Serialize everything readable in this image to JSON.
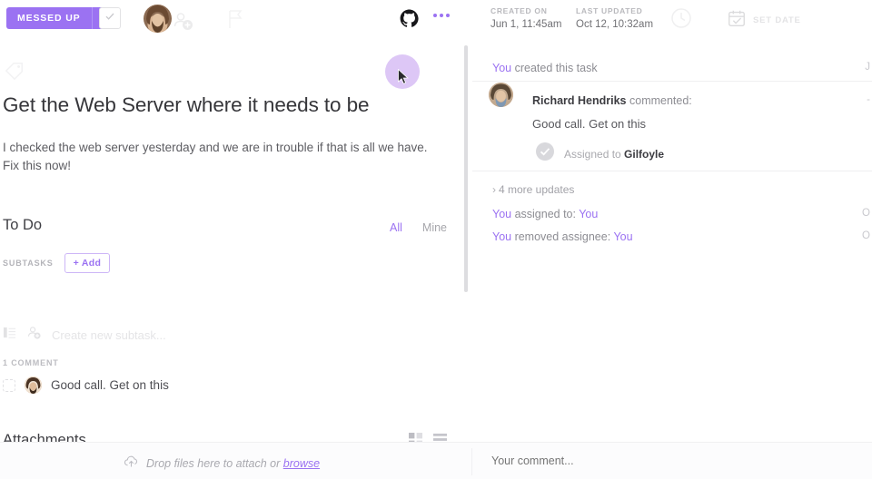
{
  "topbar": {
    "status_label": "MESSED UP",
    "status_color": "#9b72f2",
    "caret_icon": "caret-right-icon",
    "check_icon": "checkmark-icon",
    "assignee_avatar": "avatar",
    "add_assignee_icon": "add-person-icon",
    "flag_icon": "flag-icon",
    "github_icon": "github-icon",
    "more_icon": "ellipsis-icon",
    "created": {
      "label": "CREATED ON",
      "value": "Jun 1, 11:45am"
    },
    "updated": {
      "label": "LAST UPDATED",
      "value": "Oct 12, 10:32am"
    },
    "timer_icon": "clock-icon",
    "set_date": {
      "icon": "calendar-icon",
      "label": "SET DATE"
    }
  },
  "task": {
    "tag_icon": "tag-icon",
    "title": "Get the Web Server where it needs to be",
    "description": "I checked the web server yesterday and we are in trouble if that is all we have. Fix this now!"
  },
  "todo": {
    "heading": "To Do",
    "filters": [
      {
        "label": "All",
        "active": true
      },
      {
        "label": "Mine",
        "active": false
      }
    ],
    "subtasks_label": "SUBTASKS",
    "add_label": "+ Add",
    "create_placeholder": "Create new subtask...",
    "create_icons": [
      "list-icon",
      "add-person-icon"
    ]
  },
  "comments": {
    "count_label": "1 COMMENT",
    "items": [
      {
        "avatar": "avatar",
        "text": "Good call. Get on this",
        "checkbox": "checkbox-icon"
      }
    ]
  },
  "attachments": {
    "heading": "Attachments",
    "grid_view_icon": "grid-view-icon",
    "list_view_icon": "list-view-icon"
  },
  "activity": {
    "created_entry": {
      "actor": "You",
      "text": "created this task",
      "stamp": "J"
    },
    "comment_entry": {
      "avatar": "avatar",
      "author": "Richard Hendriks",
      "verb": "commented:",
      "body": "Good call. Get on this",
      "stamp": "-"
    },
    "assigned_badge": {
      "icon": "check-circle-icon",
      "prefix": "Assigned to ",
      "assignee": "Gilfoyle"
    },
    "more_updates": {
      "chevron": "chevron-right-icon",
      "label": "4 more updates"
    },
    "entries": [
      {
        "actor": "You",
        "text": " assigned to: ",
        "target": "You",
        "stamp": "O"
      },
      {
        "actor": "You",
        "text": " removed assignee: ",
        "target": "You",
        "stamp": "O"
      }
    ]
  },
  "bottom": {
    "upload_icon": "cloud-upload-icon",
    "drop_text": "Drop files here to attach or ",
    "browse_label": "browse",
    "comment_placeholder": "Your comment...",
    "comment_value": ""
  },
  "cursor": {
    "icon": "mouse-pointer-icon",
    "ripple_color": "#d7bdf4"
  }
}
